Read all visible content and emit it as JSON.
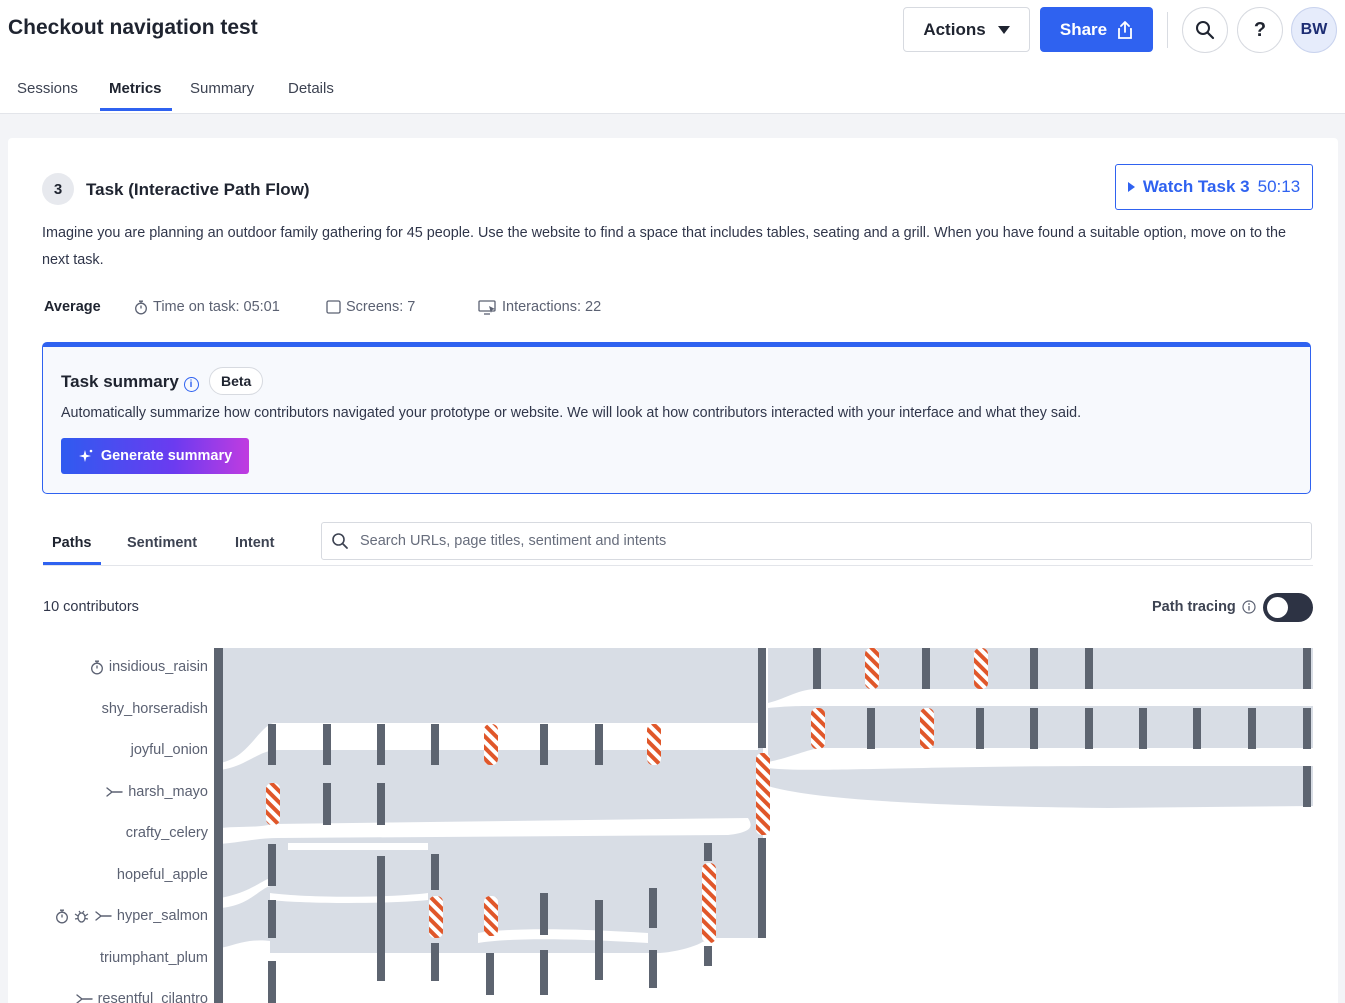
{
  "header": {
    "title": "Checkout navigation test",
    "actions_label": "Actions",
    "share_label": "Share",
    "avatar_initials": "BW",
    "tabs": [
      {
        "label": "Sessions"
      },
      {
        "label": "Metrics"
      },
      {
        "label": "Summary"
      },
      {
        "label": "Details"
      }
    ],
    "active_tab": "Metrics"
  },
  "task": {
    "number": "3",
    "title": "Task (Interactive Path Flow)",
    "watch_label": "Watch Task 3",
    "watch_time": "50:13",
    "description": "Imagine you are planning an outdoor family gathering for 45 people. Use the website to find a space that includes tables, seating and a grill. When you have found a suitable option, move on to the next task.",
    "average": {
      "label": "Average",
      "time_on_task": "Time on task: 05:01",
      "screens": "Screens: 7",
      "interactions": "Interactions: 22"
    }
  },
  "summary": {
    "title": "Task summary",
    "badge": "Beta",
    "text": "Automatically summarize how contributors navigated your prototype or website. We will look at how contributors interacted with your interface and what they said.",
    "button": "Generate summary"
  },
  "subtabs": [
    {
      "label": "Paths"
    },
    {
      "label": "Sentiment"
    },
    {
      "label": "Intent"
    }
  ],
  "search": {
    "placeholder": "Search URLs, page titles, sentiment and intents",
    "value": ""
  },
  "contributors_label": "10 contributors",
  "path_tracing": {
    "label": "Path tracing",
    "enabled": false
  },
  "contributors": [
    {
      "name": "insidious_raisin",
      "icons": [
        "timer-icon"
      ]
    },
    {
      "name": "shy_horseradish",
      "icons": []
    },
    {
      "name": "joyful_onion",
      "icons": []
    },
    {
      "name": "harsh_mayo",
      "icons": [
        "branch-icon"
      ]
    },
    {
      "name": "crafty_celery",
      "icons": []
    },
    {
      "name": "hopeful_apple",
      "icons": []
    },
    {
      "name": "hyper_salmon",
      "icons": [
        "timer-icon",
        "bug-icon",
        "branch-icon"
      ]
    },
    {
      "name": "triumphant_plum",
      "icons": []
    },
    {
      "name": "resentful_cilantro",
      "icons": [
        "branch-icon"
      ]
    }
  ],
  "colors": {
    "accent": "#2f62f0",
    "flow": "#d6dbe4",
    "node": "#5d6470",
    "misclick": "#e0572a"
  }
}
